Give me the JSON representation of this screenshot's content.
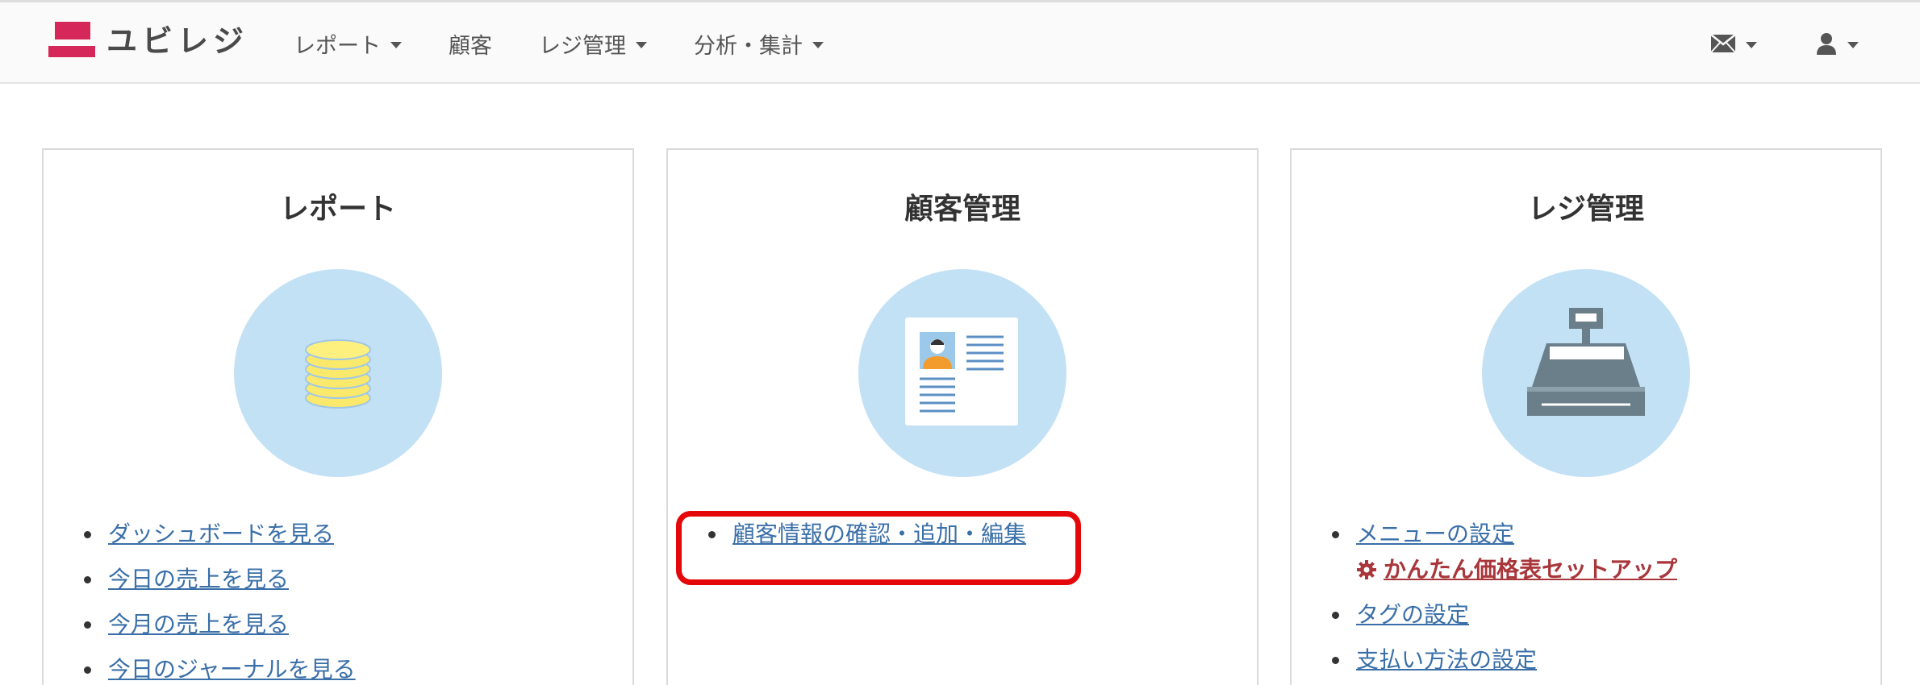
{
  "brand": {
    "name": "ユビレジ",
    "color": "#d6275a"
  },
  "nav": {
    "items": [
      {
        "label": "レポート",
        "has_dropdown": true
      },
      {
        "label": "顧客",
        "has_dropdown": false
      },
      {
        "label": "レジ管理",
        "has_dropdown": true
      },
      {
        "label": "分析・集計",
        "has_dropdown": true
      }
    ],
    "right": [
      {
        "icon": "envelope-icon",
        "has_dropdown": true
      },
      {
        "icon": "user-icon",
        "has_dropdown": true
      }
    ]
  },
  "panels": [
    {
      "title": "レポート",
      "icon": "coins-icon",
      "links": [
        "ダッシュボードを見る",
        "今日の売上を見る",
        "今月の売上を見る",
        "今日のジャーナルを見る"
      ]
    },
    {
      "title": "顧客管理",
      "icon": "customer-card-icon",
      "links": [
        "顧客情報の確認・追加・編集"
      ],
      "highlighted_link": "顧客情報の確認・追加・編集"
    },
    {
      "title": "レジ管理",
      "icon": "cash-register-icon",
      "links": [
        "メニューの設定",
        "タグの設定",
        "支払い方法の設定"
      ],
      "sub_link": {
        "icon": "gear-icon",
        "label": "かんたん価格表セットアップ"
      }
    }
  ],
  "colors": {
    "link": "#3a6fa8",
    "sub_link": "#a8363a",
    "circle": "#c3e1f5",
    "highlight": "#e4080b"
  }
}
